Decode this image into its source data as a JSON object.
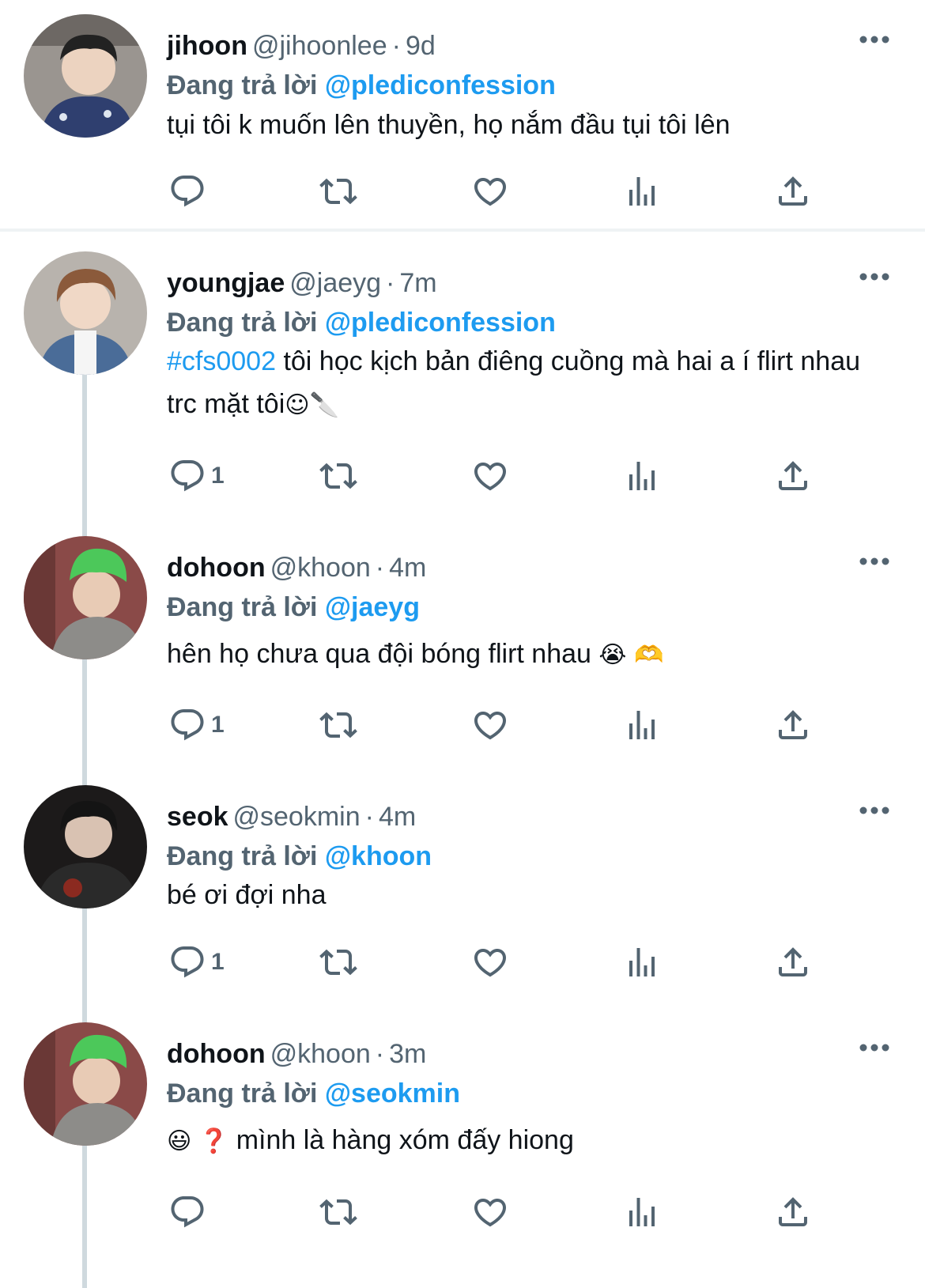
{
  "tweets": [
    {
      "name": "jihoon",
      "handle": "@jihoonlee",
      "time": "9d",
      "replying_prefix": "Đang trả lời",
      "replying_to": "@plediconfession",
      "hashtag": "",
      "text": "tụi tôi k muốn lên thuyền, họ nắm đầu tụi tôi lên",
      "emojis": "",
      "reply_count": ""
    },
    {
      "name": "youngjae",
      "handle": "@jaeyg",
      "time": "7m",
      "replying_prefix": "Đang trả lời",
      "replying_to": "@plediconfession",
      "hashtag": "#cfs0002",
      "text": " tôi học kịch bản điêng cuồng mà hai a í flirt nhau trc mặt tôi",
      "emojis": "☺🔪",
      "reply_count": "1"
    },
    {
      "name": "dohoon",
      "handle": "@khoon",
      "time": "4m",
      "replying_prefix": "Đang trả lời",
      "replying_to": "@jaeyg",
      "hashtag": "",
      "text": "hên họ chưa qua đội bóng flirt nhau ",
      "emojis": "😭 🫶",
      "reply_count": "1"
    },
    {
      "name": "seok",
      "handle": "@seokmin",
      "time": "4m",
      "replying_prefix": "Đang trả lời",
      "replying_to": "@khoon",
      "hashtag": "",
      "text": "bé ơi đợi nha",
      "emojis": "",
      "reply_count": "1"
    },
    {
      "name": "dohoon",
      "handle": "@khoon",
      "time": "3m",
      "replying_prefix": "Đang trả lời",
      "replying_to": "@seokmin",
      "hashtag": "",
      "prefix_emojis": "😃 ❓ ",
      "text": "mình là hàng xóm đấy hiong",
      "emojis": "",
      "reply_count": ""
    }
  ],
  "icons": [
    "reply-icon",
    "retweet-icon",
    "like-icon",
    "analytics-icon",
    "share-icon",
    "more-icon"
  ],
  "colors": {
    "accent": "#1d9bf0",
    "secondary_text": "#536471",
    "thread_line": "#cfd9de"
  }
}
